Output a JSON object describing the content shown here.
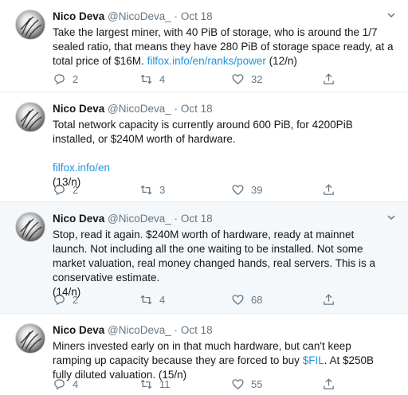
{
  "tweets": [
    {
      "name": "Nico Deva",
      "handle": "@NicoDeva_",
      "dot": "·",
      "time": "Oct 18",
      "lines": [
        "Take the largest miner, with 40 PiB of storage, who is around the 1/7",
        "sealed ratio, that means they have 280 PiB of storage space ready, at a",
        "total price of $16M. "
      ],
      "inline_link": "filfox.info/en/ranks/power",
      "inline_suffix": " (12/n)",
      "replies": "2",
      "retweets": "4",
      "likes": "32"
    },
    {
      "name": "Nico Deva",
      "handle": "@NicoDeva_",
      "dot": "·",
      "time": "Oct 18",
      "lines": [
        "Total network capacity is currently around 600 PiB, for 4200PiB",
        "installed, or $240M worth of hardware."
      ],
      "link_line": "filfox.info/en",
      "suffix_line": "(13/n)",
      "replies": "2",
      "retweets": "3",
      "likes": "39"
    },
    {
      "name": "Nico Deva",
      "handle": "@NicoDeva_",
      "dot": "·",
      "time": "Oct 18",
      "lines": [
        "Stop, read it again. $240M worth of hardware, ready at mainnet",
        "launch. Not including all the one waiting to be installed. Not some",
        "market valuation, real money changed hands, real servers. This is a",
        "conservative estimate.",
        "(14/n)"
      ],
      "replies": "2",
      "retweets": "4",
      "likes": "68"
    },
    {
      "name": "Nico Deva",
      "handle": "@NicoDeva_",
      "dot": "·",
      "time": "Oct 18",
      "lines": [
        "Miners invested early on in that much hardware, but can't keep",
        "ramping up capacity because they are forced to buy "
      ],
      "cashtag": "$FIL",
      "cashtag_suffix": ". At $250B",
      "last_line": "fully diluted valuation. (15/n)",
      "replies": "4",
      "retweets": "11",
      "likes": "55"
    }
  ],
  "colors": {
    "link": "#1b95e0",
    "muted": "#657786",
    "border": "#e6ecf0",
    "highlight_bg": "#f5f8fa"
  },
  "icons": [
    "avatar",
    "chevron-down-icon",
    "reply-icon",
    "retweet-icon",
    "like-icon",
    "share-icon"
  ]
}
